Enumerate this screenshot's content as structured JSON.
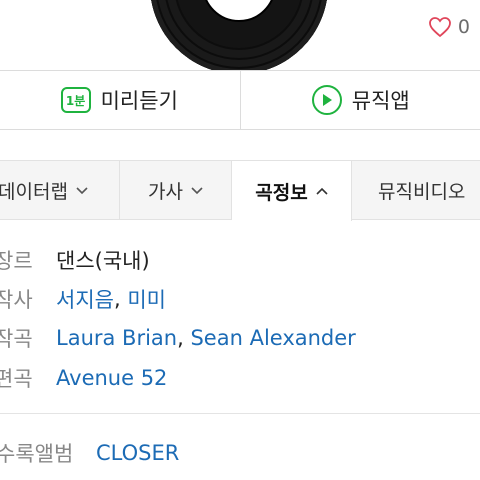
{
  "like": {
    "count": "0"
  },
  "actions": {
    "preview_badge": "1분",
    "preview_label": "미리듣기",
    "musicapp_label": "뮤직앱"
  },
  "tabs": [
    {
      "label": "데이터랩",
      "state": "collapsed"
    },
    {
      "label": "가사",
      "state": "collapsed"
    },
    {
      "label": "곡정보",
      "state": "expanded",
      "selected": true
    },
    {
      "label": "뮤직비디오"
    }
  ],
  "info": {
    "genre": {
      "label": "장르",
      "value": "댄스(국내)"
    },
    "lyricist": {
      "label": "작사",
      "names": [
        "서지음",
        "미미"
      ]
    },
    "composer": {
      "label": "작곡",
      "names": [
        "Laura Brian",
        "Sean Alexander"
      ]
    },
    "arranger": {
      "label": "편곡",
      "names": [
        "Avenue 52"
      ]
    },
    "album": {
      "label": "수록앨범",
      "value": "CLOSER"
    }
  },
  "colors": {
    "accent_green": "#1fb33f",
    "link_blue": "#1c6bb5",
    "heart_red": "#e0455a"
  }
}
